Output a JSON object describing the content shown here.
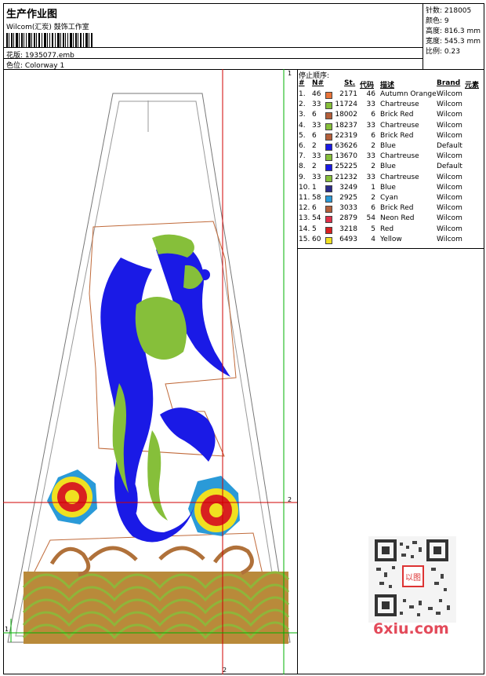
{
  "header": {
    "title": "生产作业图",
    "studio": "Wilcom(汇炭) 鼓饰工作室",
    "design_label": "花版: 1935077.emb",
    "colorway_label": "色位: Colorway 1"
  },
  "stats": {
    "stitches": "针数: 218005",
    "colors": "颜色: 9",
    "height": "高度: 816.3 mm",
    "width": "宽度: 545.3 mm",
    "scale": "比例: 0.23"
  },
  "sequence": {
    "title": "停止顺序:",
    "headers": {
      "num": "#",
      "n": "N#",
      "st": "St.",
      "code": "代码",
      "desc": "描述",
      "brand": "Brand",
      "elem": "元素"
    },
    "rows": [
      {
        "num": "1.",
        "n": "46",
        "color": "#e8743a",
        "st": "2171",
        "code": "46",
        "desc": "Autumn Orange",
        "brand": "Wilcom"
      },
      {
        "num": "2.",
        "n": "33",
        "color": "#86bf3a",
        "st": "11724",
        "code": "33",
        "desc": "Chartreuse",
        "brand": "Wilcom"
      },
      {
        "num": "3.",
        "n": "6",
        "color": "#b45f3a",
        "st": "18002",
        "code": "6",
        "desc": "Brick Red",
        "brand": "Wilcom"
      },
      {
        "num": "4.",
        "n": "33",
        "color": "#86bf3a",
        "st": "18237",
        "code": "33",
        "desc": "Chartreuse",
        "brand": "Wilcom"
      },
      {
        "num": "5.",
        "n": "6",
        "color": "#b45f3a",
        "st": "22319",
        "code": "6",
        "desc": "Brick Red",
        "brand": "Wilcom"
      },
      {
        "num": "6.",
        "n": "2",
        "color": "#1a1ae6",
        "st": "63626",
        "code": "2",
        "desc": "Blue",
        "brand": "Default"
      },
      {
        "num": "7.",
        "n": "33",
        "color": "#86bf3a",
        "st": "13670",
        "code": "33",
        "desc": "Chartreuse",
        "brand": "Wilcom"
      },
      {
        "num": "8.",
        "n": "2",
        "color": "#1a1ae6",
        "st": "25225",
        "code": "2",
        "desc": "Blue",
        "brand": "Default"
      },
      {
        "num": "9.",
        "n": "33",
        "color": "#86bf3a",
        "st": "21232",
        "code": "33",
        "desc": "Chartreuse",
        "brand": "Wilcom"
      },
      {
        "num": "10.",
        "n": "1",
        "color": "#2a2a8a",
        "st": "3249",
        "code": "1",
        "desc": "Blue",
        "brand": "Wilcom"
      },
      {
        "num": "11.",
        "n": "58",
        "color": "#2a9ad8",
        "st": "2925",
        "code": "2",
        "desc": "Cyan",
        "brand": "Wilcom"
      },
      {
        "num": "12.",
        "n": "6",
        "color": "#b45f3a",
        "st": "3033",
        "code": "6",
        "desc": "Brick Red",
        "brand": "Wilcom"
      },
      {
        "num": "13.",
        "n": "54",
        "color": "#e0304a",
        "st": "2879",
        "code": "54",
        "desc": "Neon Red",
        "brand": "Wilcom"
      },
      {
        "num": "14.",
        "n": "5",
        "color": "#d82020",
        "st": "3218",
        "code": "5",
        "desc": "Red",
        "brand": "Wilcom"
      },
      {
        "num": "15.",
        "n": "60",
        "color": "#f0e020",
        "st": "6493",
        "code": "4",
        "desc": "Yellow",
        "brand": "Wilcom"
      }
    ]
  },
  "marks": {
    "one": "1",
    "two": "2",
    "one_b": "1",
    "two_b": "2"
  },
  "watermark": {
    "logo": "6xiu.com",
    "seal_char": "以图"
  },
  "colors": {
    "blue": "#1a1ae6",
    "green": "#86bf3a",
    "brown": "#b0713a",
    "red": "#d82020",
    "yellow": "#f0e020",
    "cyan": "#2a9ad8",
    "guide_red": "#d00000",
    "guide_green": "#00b000"
  }
}
